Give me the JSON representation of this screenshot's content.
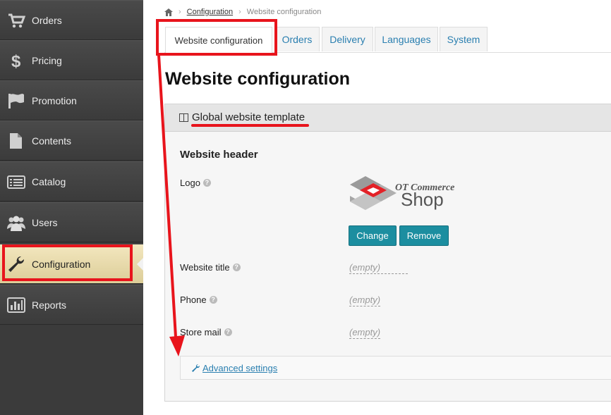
{
  "sidebar": {
    "items": [
      {
        "label": "Orders",
        "icon": "cart-icon"
      },
      {
        "label": "Pricing",
        "icon": "dollar-icon"
      },
      {
        "label": "Promotion",
        "icon": "flag-icon"
      },
      {
        "label": "Contents",
        "icon": "document-icon"
      },
      {
        "label": "Catalog",
        "icon": "list-icon"
      },
      {
        "label": "Users",
        "icon": "users-icon"
      },
      {
        "label": "Configuration",
        "icon": "wrench-icon",
        "active": true
      },
      {
        "label": "Reports",
        "icon": "bar-chart-icon"
      }
    ]
  },
  "breadcrumb": {
    "home_icon": "home-icon",
    "link": "Configuration",
    "current": "Website configuration"
  },
  "tabs": [
    {
      "label": "Website configuration",
      "active": true
    },
    {
      "label": "Orders"
    },
    {
      "label": "Delivery"
    },
    {
      "label": "Languages"
    },
    {
      "label": "System"
    }
  ],
  "page_title": "Website configuration",
  "panel": {
    "title": "Global website template",
    "section_title": "Website header",
    "fields": {
      "logo_label": "Logo",
      "website_title_label": "Website title",
      "website_title_value": "(empty)",
      "phone_label": "Phone",
      "phone_value": "(empty)",
      "store_mail_label": "Store mail",
      "store_mail_value": "(empty)"
    },
    "logo_text": {
      "top": "OT Commerce",
      "bottom": "Shop"
    },
    "buttons": {
      "change": "Change",
      "remove": "Remove"
    },
    "advanced_link": "Advanced settings"
  },
  "colors": {
    "annotation_red": "#e8141c",
    "button_teal": "#1c8ea0",
    "link_blue": "#2a7fb0"
  }
}
